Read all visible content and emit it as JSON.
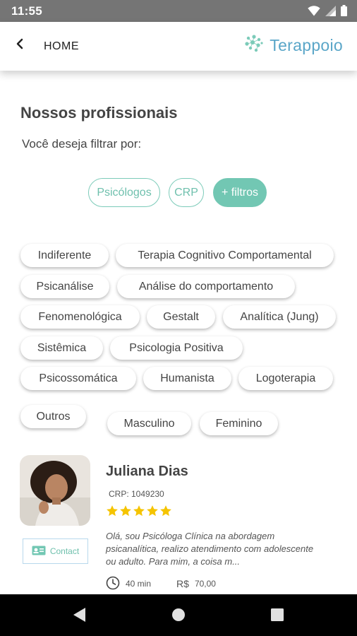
{
  "status_bar": {
    "time": "11:55"
  },
  "header": {
    "back_label": "HOME",
    "brand": "Terappoio"
  },
  "main": {
    "title": "Nossos profissionais",
    "subtitle": "Você deseja filtrar por:",
    "tabs": [
      {
        "label": "Psicólogos",
        "active": false
      },
      {
        "label": "CRP",
        "active": false
      },
      {
        "label": "+ filtros",
        "active": true
      }
    ],
    "approach_chips": [
      "Indiferente",
      "Terapia Cognitivo Comportamental",
      "Psicanálise",
      "Análise do comportamento",
      "Fenomenológica",
      "Gestalt",
      "Analítica (Jung)",
      "Sistêmica",
      "Psicologia Positiva",
      "Psicossomática",
      "Humanista",
      "Logoterapia",
      "Outros"
    ],
    "gender_chips": [
      "Masculino",
      "Feminino"
    ]
  },
  "professional": {
    "name": "Juliana Dias",
    "crp": "CRP: 1049230",
    "rating": 5,
    "bio": "Olá, sou Psicóloga Clínica na abordagem psicanalítica, realizo atendimento com adolescente ou adulto. Para mim, a coisa m...",
    "duration": "40 min",
    "currency": "R$",
    "price": "70,00",
    "contact_label": "Contact"
  },
  "colors": {
    "accent": "#72c7b3",
    "brand": "#5aa6c8",
    "star": "#f5c400",
    "status_bar": "#757575",
    "nav_bar": "#000000"
  },
  "icons": [
    "wifi-icon",
    "signal-icon",
    "battery-icon",
    "back-arrow-icon",
    "brand-logo-icon",
    "star-icon",
    "contact-card-icon",
    "clock-icon",
    "nav-back-icon",
    "nav-home-icon",
    "nav-recents-icon"
  ]
}
